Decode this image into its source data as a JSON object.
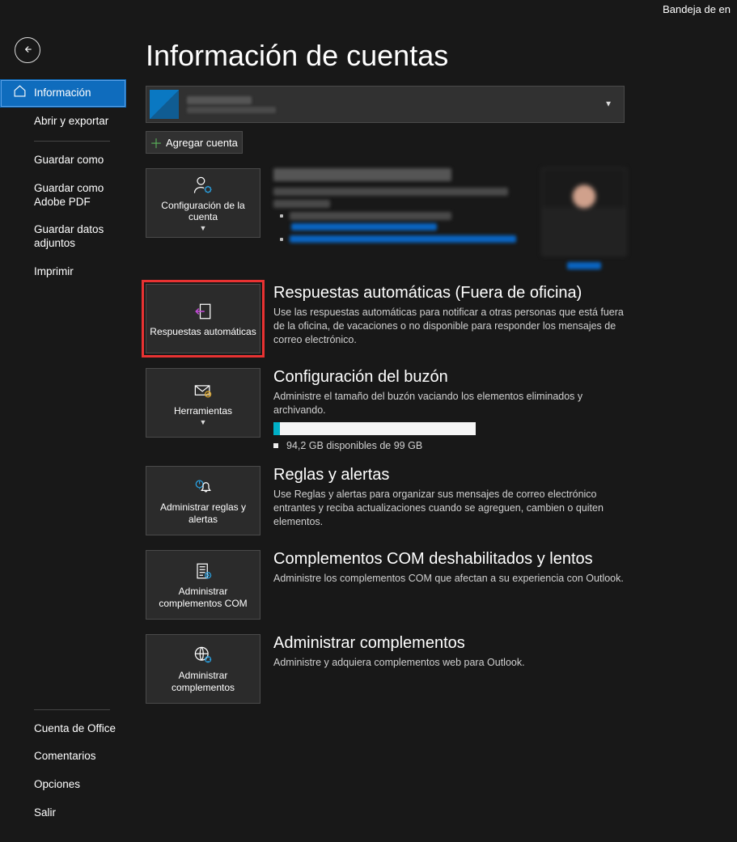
{
  "titlebar": "Bandeja de en",
  "sidebar": {
    "items": [
      {
        "label": "Información"
      },
      {
        "label": "Abrir y exportar"
      },
      {
        "label": "Guardar como"
      },
      {
        "label": "Guardar como Adobe PDF"
      },
      {
        "label": "Guardar datos adjuntos"
      },
      {
        "label": "Imprimir"
      }
    ],
    "footer": [
      {
        "label": "Cuenta de Office"
      },
      {
        "label": "Comentarios"
      },
      {
        "label": "Opciones"
      },
      {
        "label": "Salir"
      }
    ]
  },
  "page": {
    "title": "Información de cuentas",
    "add_account": "Agregar cuenta"
  },
  "sections": {
    "config": {
      "tile": "Configuración de la cuenta"
    },
    "auto": {
      "tile": "Respuestas automáticas",
      "title": "Respuestas automáticas (Fuera de oficina)",
      "desc": "Use las respuestas automáticas para notificar a otras personas que está fuera de la oficina, de vacaciones o no disponible para responder los mensajes de correo electrónico."
    },
    "mailbox": {
      "tile": "Herramientas",
      "title": "Configuración del buzón",
      "desc": "Administre el tamaño del buzón vaciando los elementos eliminados y archivando.",
      "storage": "94,2 GB disponibles de 99 GB",
      "progress_pct": 3
    },
    "rules": {
      "tile": "Administrar reglas y alertas",
      "title": "Reglas y alertas",
      "desc": "Use Reglas y alertas para organizar sus mensajes de correo electrónico entrantes y reciba actualizaciones cuando se agreguen, cambien o quiten elementos."
    },
    "com": {
      "tile": "Administrar complementos COM",
      "title": "Complementos COM deshabilitados y lentos",
      "desc": "Administre los complementos COM que afectan a su experiencia con Outlook."
    },
    "addins": {
      "tile": "Administrar complementos",
      "title": "Administrar complementos",
      "desc": "Administre y adquiera complementos web para Outlook."
    }
  }
}
